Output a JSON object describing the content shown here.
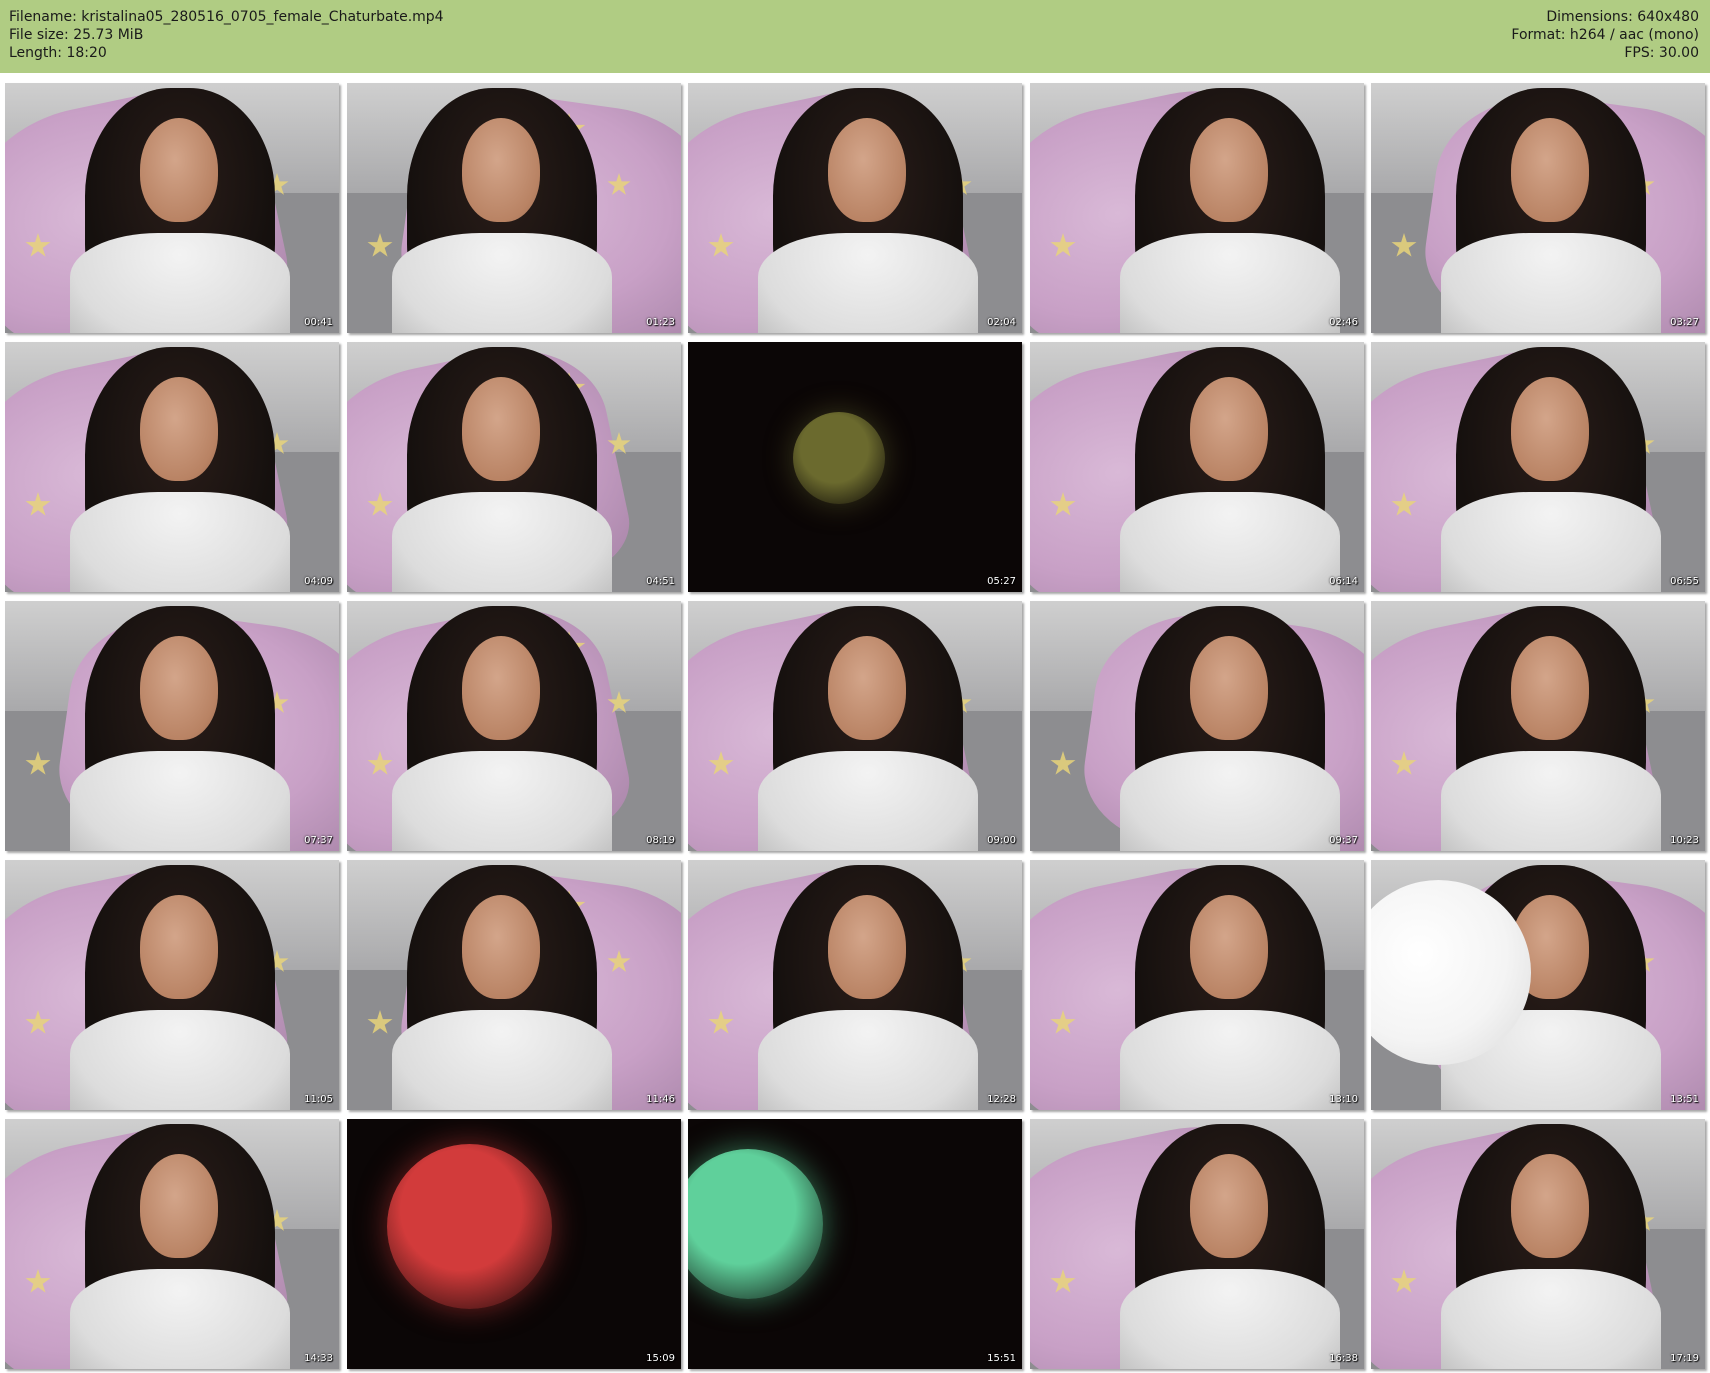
{
  "header": {
    "filename_line": "Filename: kristalina05_280516_0705_female_Chaturbate.mp4",
    "filesize_line": "File size: 25.73 MiB",
    "length_line": "Length: 18:20",
    "dimensions_line": "Dimensions: 640x480",
    "format_line": "Format: h264 / aac (mono)",
    "fps_line": "FPS: 30.00",
    "background_color": "#b0cc83"
  },
  "thumbnails": [
    {
      "timestamp": "00:41",
      "scene": "webcam"
    },
    {
      "timestamp": "01:23",
      "scene": "webcam"
    },
    {
      "timestamp": "02:04",
      "scene": "webcam"
    },
    {
      "timestamp": "02:46",
      "scene": "webcam"
    },
    {
      "timestamp": "03:27",
      "scene": "webcam"
    },
    {
      "timestamp": "04:09",
      "scene": "webcam"
    },
    {
      "timestamp": "04:51",
      "scene": "webcam"
    },
    {
      "timestamp": "05:27",
      "scene": "dark-yellow-balloon"
    },
    {
      "timestamp": "06:14",
      "scene": "webcam"
    },
    {
      "timestamp": "06:55",
      "scene": "webcam"
    },
    {
      "timestamp": "07:37",
      "scene": "webcam"
    },
    {
      "timestamp": "08:19",
      "scene": "webcam"
    },
    {
      "timestamp": "09:00",
      "scene": "webcam"
    },
    {
      "timestamp": "09:37",
      "scene": "webcam"
    },
    {
      "timestamp": "10:23",
      "scene": "webcam"
    },
    {
      "timestamp": "11:05",
      "scene": "webcam"
    },
    {
      "timestamp": "11:46",
      "scene": "webcam"
    },
    {
      "timestamp": "12:28",
      "scene": "webcam"
    },
    {
      "timestamp": "13:10",
      "scene": "webcam"
    },
    {
      "timestamp": "13:51",
      "scene": "white-balloon"
    },
    {
      "timestamp": "14:33",
      "scene": "webcam"
    },
    {
      "timestamp": "15:09",
      "scene": "dark-red-balloon"
    },
    {
      "timestamp": "15:51",
      "scene": "dark-green-balloon"
    },
    {
      "timestamp": "16:38",
      "scene": "webcam"
    },
    {
      "timestamp": "17:19",
      "scene": "webcam"
    }
  ]
}
